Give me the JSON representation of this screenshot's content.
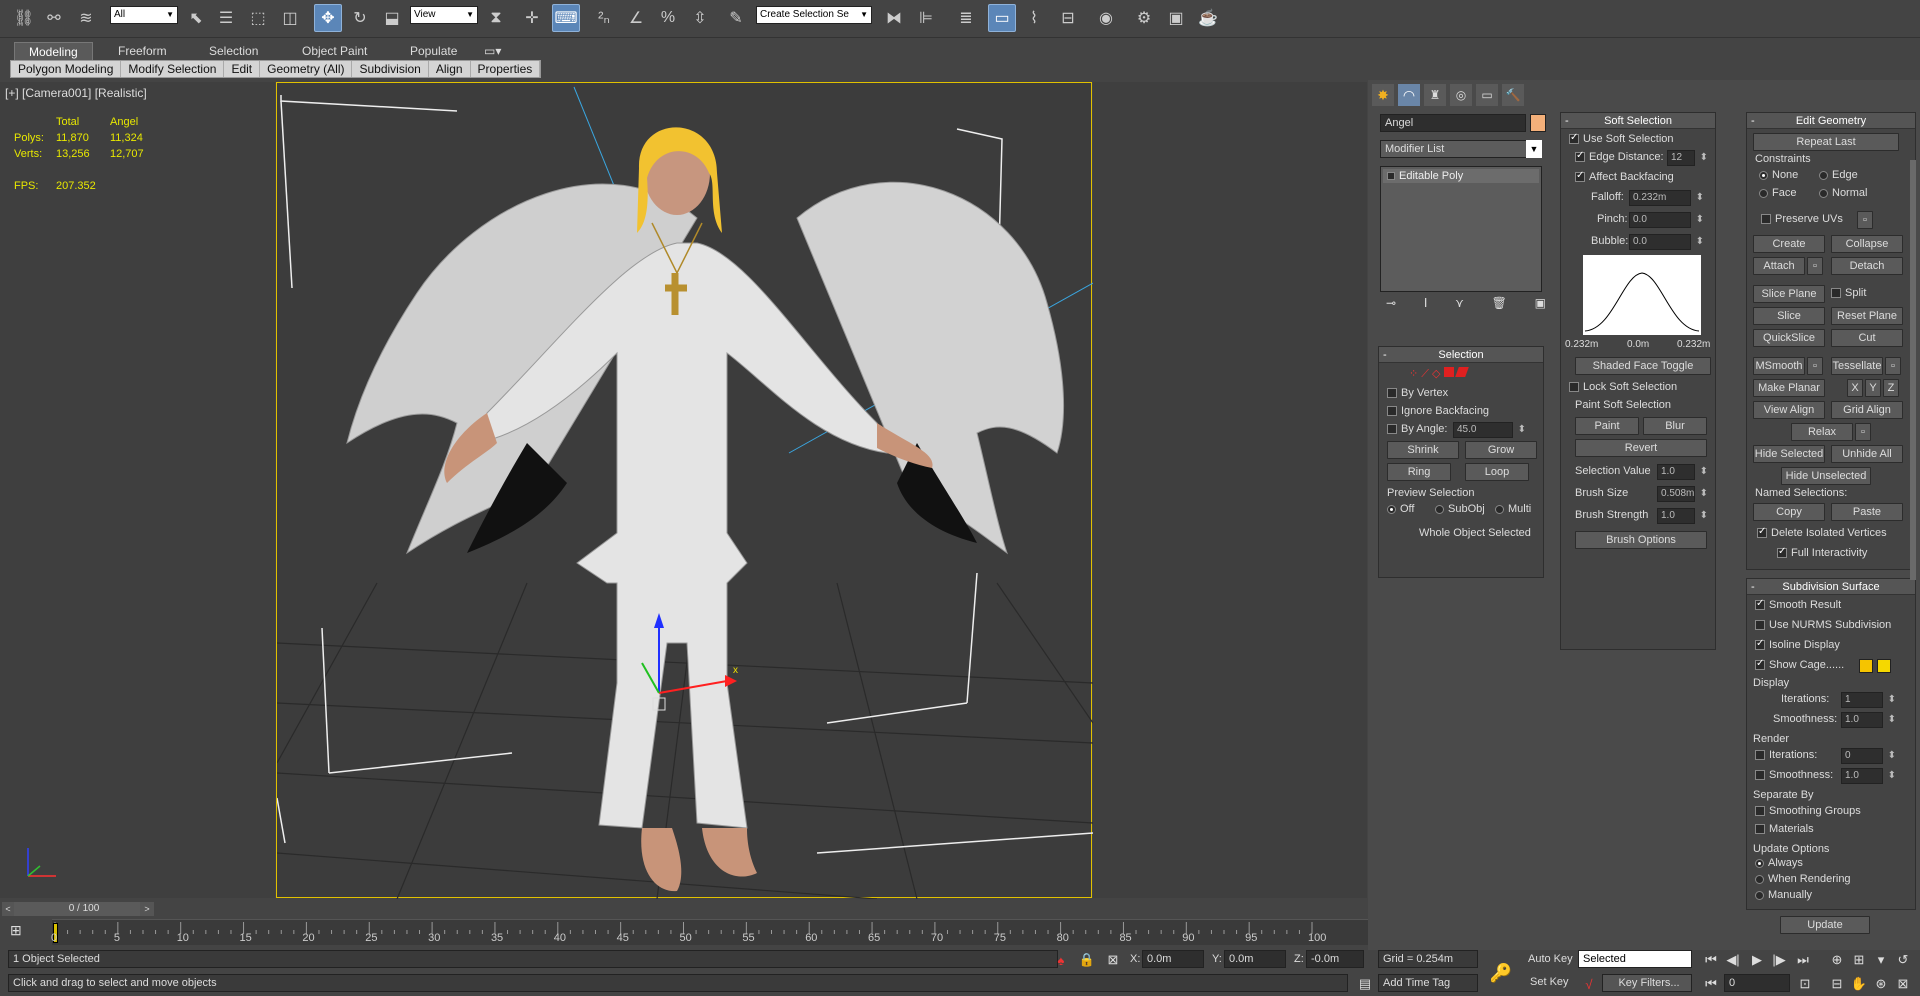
{
  "toolbar": {
    "filter_dropdown": "All",
    "ref_coord_dropdown": "View",
    "named_selection_dropdown": "Create Selection Se"
  },
  "ribbon": {
    "tabs": [
      "Modeling",
      "Freeform",
      "Selection",
      "Object Paint",
      "Populate"
    ],
    "active_tab": "Modeling",
    "subtabs": [
      "Polygon Modeling",
      "Modify Selection",
      "Edit",
      "Geometry (All)",
      "Subdivision",
      "Align",
      "Properties"
    ]
  },
  "viewport": {
    "label": "[+] [Camera001] [Realistic]",
    "stats": {
      "col_total": "Total",
      "col_angel": "Angel",
      "polys_label": "Polys:",
      "polys_total": "11,870",
      "polys_angel": "11,324",
      "verts_label": "Verts:",
      "verts_total": "13,256",
      "verts_angel": "12,707",
      "fps_label": "FPS:",
      "fps_value": "207.352"
    },
    "axis_x": "x"
  },
  "command_panel": {
    "object_name": "Angel",
    "object_color": "#f4b07a",
    "modifier_list": "Modifier List",
    "stack_item": "Editable Poly",
    "selection": {
      "title": "Selection",
      "by_vertex": "By Vertex",
      "ignore_backfacing": "Ignore Backfacing",
      "by_angle": "By Angle:",
      "by_angle_value": "45.0",
      "shrink": "Shrink",
      "grow": "Grow",
      "ring": "Ring",
      "loop": "Loop",
      "preview_selection": "Preview Selection",
      "preview_off": "Off",
      "preview_subobj": "SubObj",
      "preview_multi": "Multi",
      "status": "Whole Object Selected"
    },
    "soft_selection": {
      "title": "Soft Selection",
      "use_soft_selection": "Use Soft Selection",
      "edge_distance": "Edge Distance:",
      "edge_distance_value": "12",
      "affect_backfacing": "Affect Backfacing",
      "falloff": "Falloff:",
      "falloff_value": "0.232m",
      "pinch": "Pinch:",
      "pinch_value": "0.0",
      "bubble": "Bubble:",
      "bubble_value": "0.0",
      "curve_left": "0.232m",
      "curve_mid": "0.0m",
      "curve_right": "0.232m",
      "shaded_face_toggle": "Shaded Face Toggle",
      "lock_soft_selection": "Lock Soft Selection",
      "paint_soft_selection": "Paint Soft Selection",
      "paint": "Paint",
      "blur": "Blur",
      "revert": "Revert",
      "selection_value": "Selection Value",
      "selection_value_v": "1.0",
      "brush_size": "Brush Size",
      "brush_size_v": "0.508m",
      "brush_strength": "Brush Strength",
      "brush_strength_v": "1.0",
      "brush_options": "Brush Options"
    },
    "edit_geometry": {
      "title": "Edit Geometry",
      "repeat_last": "Repeat Last",
      "constraints": "Constraints",
      "none": "None",
      "edge": "Edge",
      "face": "Face",
      "normal": "Normal",
      "preserve_uvs": "Preserve UVs",
      "create": "Create",
      "collapse": "Collapse",
      "attach": "Attach",
      "detach": "Detach",
      "slice_plane": "Slice Plane",
      "split": "Split",
      "slice": "Slice",
      "reset_plane": "Reset Plane",
      "quickslice": "QuickSlice",
      "cut": "Cut",
      "msmooth": "MSmooth",
      "tessellate": "Tessellate",
      "make_planar": "Make Planar",
      "x": "X",
      "y": "Y",
      "z": "Z",
      "view_align": "View Align",
      "grid_align": "Grid Align",
      "relax": "Relax",
      "hide_selected": "Hide Selected",
      "unhide_all": "Unhide All",
      "hide_unselected": "Hide Unselected",
      "named_selections": "Named Selections:",
      "copy": "Copy",
      "paste": "Paste",
      "delete_isolated": "Delete Isolated Vertices",
      "full_interactivity": "Full Interactivity"
    },
    "subdivision_surface": {
      "title": "Subdivision Surface",
      "smooth_result": "Smooth Result",
      "use_nurms": "Use NURMS Subdivision",
      "isoline_display": "Isoline Display",
      "show_cage": "Show Cage......",
      "cage_color1": "#f5c400",
      "cage_color2": "#f5d800",
      "display": "Display",
      "iterations": "Iterations:",
      "display_iterations_v": "1",
      "smoothness": "Smoothness:",
      "display_smoothness_v": "1.0",
      "render": "Render",
      "render_iterations_v": "0",
      "render_smoothness_v": "1.0",
      "separate_by": "Separate By",
      "smoothing_groups": "Smoothing Groups",
      "materials": "Materials",
      "update_options": "Update Options",
      "always": "Always",
      "when_rendering": "When Rendering",
      "manually": "Manually",
      "update": "Update"
    }
  },
  "timeline": {
    "frame_counter": "0 / 100",
    "ticks": [
      "0",
      "5",
      "10",
      "15",
      "20",
      "25",
      "30",
      "35",
      "40",
      "45",
      "50",
      "55",
      "60",
      "65",
      "70",
      "75",
      "80",
      "85",
      "90",
      "95",
      "100"
    ]
  },
  "status": {
    "selection_info": "1 Object Selected",
    "prompt": "Click and drag to select and move objects",
    "x_label": "X:",
    "x_value": "0.0m",
    "y_label": "Y:",
    "y_value": "0.0m",
    "z_label": "Z:",
    "z_value": "-0.0m",
    "grid": "Grid = 0.254m",
    "add_time_tag": "Add Time Tag",
    "auto_key": "Auto Key",
    "set_key": "Set Key",
    "key_mode": "Selected",
    "key_filters": "Key Filters...",
    "current_frame": "0"
  }
}
